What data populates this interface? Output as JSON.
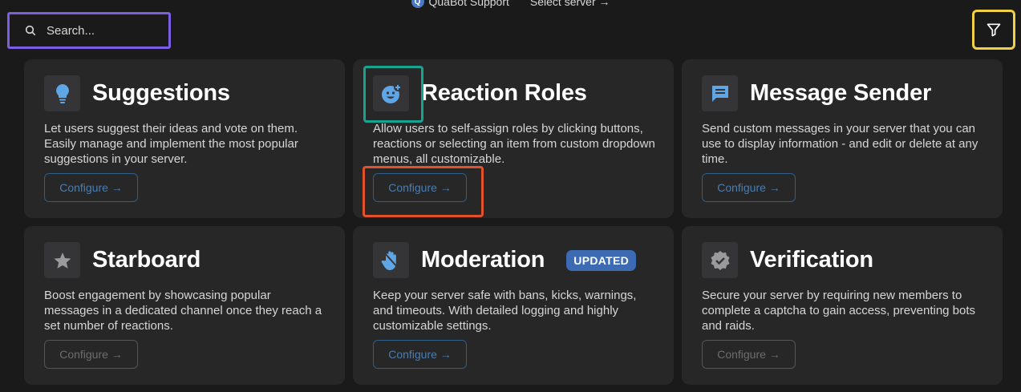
{
  "header": {
    "brand_logo_letter": "Q",
    "brand_name": "QuaBot Support",
    "select_server": "Select server →"
  },
  "search": {
    "placeholder": "Search..."
  },
  "cards": [
    {
      "title": "Suggestions",
      "icon": "lightbulb-icon",
      "desc": "Let users suggest their ideas and vote on them. Easily manage and implement the most popular suggestions in your server.",
      "button": "Configure →",
      "enabled": true
    },
    {
      "title": "Reaction Roles",
      "icon": "emoji-add-icon",
      "desc": "Allow users to self-assign roles by clicking buttons, reactions or selecting an item from custom dropdown menus, all customizable.",
      "button": "Configure →",
      "enabled": true
    },
    {
      "title": "Message Sender",
      "icon": "message-icon",
      "desc": "Send custom messages in your server that you can use to display information - and edit or delete at any time.",
      "button": "Configure →",
      "enabled": true
    },
    {
      "title": "Starboard",
      "icon": "star-icon",
      "desc": "Boost engagement by showcasing popular messages in a dedicated channel once they reach a set number of reactions.",
      "button": "Configure →",
      "enabled": false
    },
    {
      "title": "Moderation",
      "badge": "UPDATED",
      "icon": "hand-icon",
      "desc": "Keep your server safe with bans, kicks, warnings, and timeouts. With detailed logging and highly customizable settings.",
      "button": "Configure →",
      "enabled": true
    },
    {
      "title": "Verification",
      "icon": "verified-badge-icon",
      "desc": "Secure your server by requiring new members to complete a captcha to gain access, preventing bots and raids.",
      "button": "Configure →",
      "enabled": false
    }
  ],
  "colors": {
    "background": "#1a1a1b",
    "card": "#272728",
    "accent_blue": "#4a7eb1",
    "icon_blue": "#5ea6e6",
    "badge": "#3c6bb3"
  }
}
